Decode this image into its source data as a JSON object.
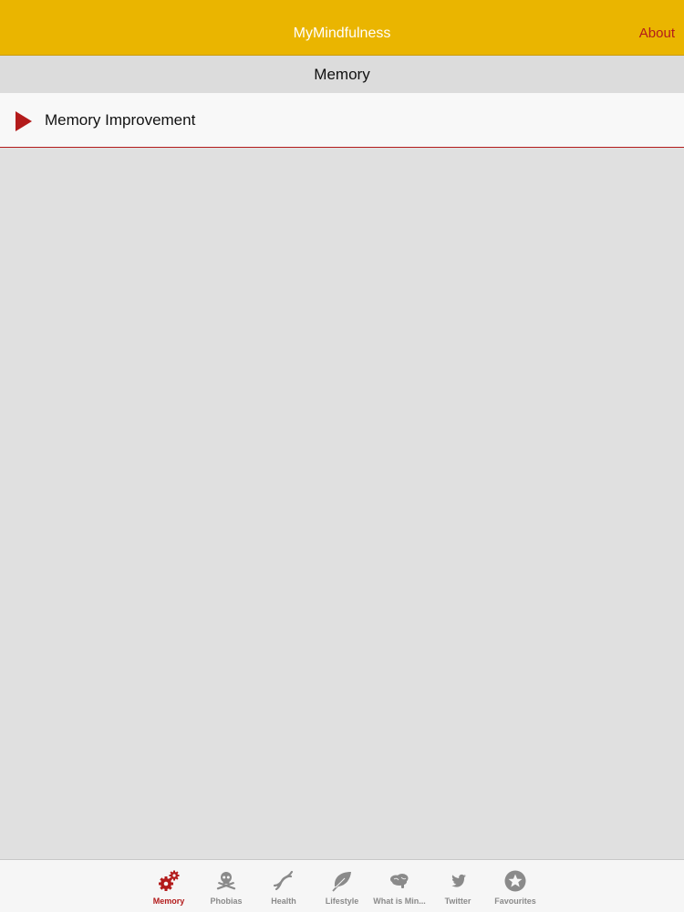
{
  "navbar": {
    "title": "MyMindfulness",
    "about_label": "About"
  },
  "section": {
    "title": "Memory"
  },
  "list": {
    "items": [
      {
        "label": "Memory Improvement"
      }
    ]
  },
  "tabbar": {
    "tabs": [
      {
        "label": "Memory",
        "icon": "gears-icon",
        "active": true
      },
      {
        "label": "Phobias",
        "icon": "skull-crossbones-icon",
        "active": false
      },
      {
        "label": "Health",
        "icon": "dna-icon",
        "active": false
      },
      {
        "label": "Lifestyle",
        "icon": "leaf-icon",
        "active": false
      },
      {
        "label": "What is Min...",
        "icon": "brain-icon",
        "active": false
      },
      {
        "label": "Twitter",
        "icon": "twitter-bird-icon",
        "active": false
      },
      {
        "label": "Favourites",
        "icon": "star-icon",
        "active": false
      }
    ]
  },
  "colors": {
    "navbar": "#eab500",
    "accent": "#b31b1b",
    "inactive": "#8a8a8a",
    "background": "#e0e0e0"
  }
}
